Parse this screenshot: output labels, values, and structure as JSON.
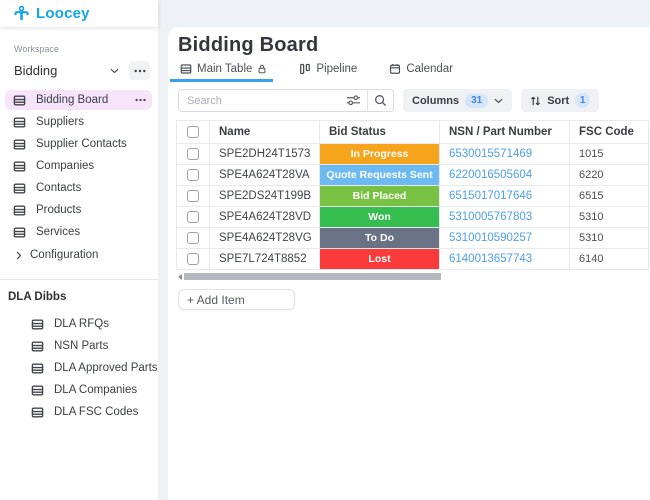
{
  "app": {
    "name": "Loocey",
    "brand_color": "#14a5e3"
  },
  "sidebar": {
    "workspace_label": "Workspace",
    "workspace_name": "Bidding",
    "selected_item": "Bidding Board",
    "items": [
      "Suppliers",
      "Supplier Contacts",
      "Companies",
      "Contacts",
      "Products",
      "Services"
    ],
    "configuration_label": "Configuration",
    "group_title": "DLA Dibbs",
    "group_items": [
      "DLA RFQs",
      "NSN Parts",
      "DLA Approved Parts",
      "DLA Companies",
      "DLA FSC Codes"
    ]
  },
  "header": {
    "title": "Bidding Board",
    "tabs": [
      {
        "label": "Main Table",
        "icon": "table-icon",
        "locked": true,
        "active": true
      },
      {
        "label": "Pipeline",
        "icon": "kanban-icon"
      },
      {
        "label": "Calendar",
        "icon": "calendar-icon"
      }
    ],
    "active_tab_underline_color": "#38a2f0"
  },
  "toolbar": {
    "search_placeholder": "Search",
    "columns_label": "Columns",
    "columns_count": "31",
    "sort_label": "Sort",
    "sort_count": "1",
    "badge_bg": "#d5e6fa",
    "badge_text_color": "#3f87dc"
  },
  "table": {
    "columns": [
      "Name",
      "Bid Status",
      "NSN / Part Number",
      "FSC Code"
    ],
    "link_color": "#4d9fe8",
    "rows": [
      {
        "name": "SPE2DH24T1573",
        "status": "In Progress",
        "status_color": "#F6A41B",
        "nsn": "6530015571469",
        "fsc": "1015"
      },
      {
        "name": "SPE4A624T28VA",
        "status": "Quote Requests Sent",
        "status_color": "#6DBAF2",
        "nsn": "6220016505604",
        "fsc": "6220"
      },
      {
        "name": "SPE2DS24T199B",
        "status": "Bid Placed",
        "status_color": "#79C142",
        "nsn": "6515017017646",
        "fsc": "6515"
      },
      {
        "name": "SPE4A624T28VD",
        "status": "Won",
        "status_color": "#35BE4F",
        "nsn": "5310005767803",
        "fsc": "5310"
      },
      {
        "name": "SPE4A624T28VG",
        "status": "To Do",
        "status_color": "#6A7286",
        "nsn": "5310010590257",
        "fsc": "5310"
      },
      {
        "name": "SPE7L724T8852",
        "status": "Lost",
        "status_color": "#FB3B3B",
        "nsn": "6140013657743",
        "fsc": "6140"
      }
    ],
    "add_item_label": "+ Add Item"
  },
  "icons": {
    "logo": "loocey-person-icon",
    "sidebar_item": "table-icon",
    "workspace_caret": "chevron-down-icon",
    "menus": "ellipsis-icon",
    "configuration": "chevron-right-icon",
    "search_filter": "sliders-icon",
    "search": "magnifier-icon",
    "columns_caret": "chevron-down-icon",
    "sort": "arrows-up-down-icon",
    "main_table_lock": "lock-icon"
  },
  "selected_item_bg": "#f7e3fa"
}
